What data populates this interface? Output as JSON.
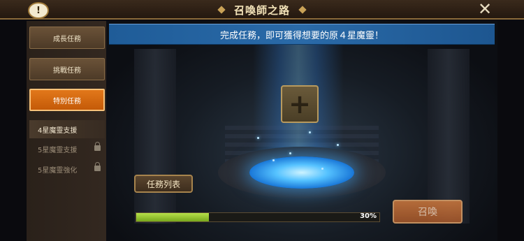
{
  "titlebar": {
    "title": "召喚師之路",
    "help_icon": "speech-bubble-exclamation-icon",
    "close_icon": "close-x-icon"
  },
  "sidebar": {
    "tabs": [
      {
        "label": "成長任務",
        "active": false
      },
      {
        "label": "挑戰任務",
        "active": false
      },
      {
        "label": "特別任務",
        "active": true
      }
    ],
    "sub_items": [
      {
        "label": "4星魔靈支援",
        "active": true,
        "locked": false
      },
      {
        "label": "5星魔靈支援",
        "active": false,
        "locked": true
      },
      {
        "label": "5星魔靈強化",
        "active": false,
        "locked": true
      }
    ]
  },
  "main": {
    "banner_text": "完成任務，即可獲得想要的原４星魔靈！",
    "slot_icon": "plus-icon",
    "list_button": "任務列表",
    "progress": {
      "value": 30,
      "label": "30%"
    },
    "summon_button": "召喚"
  },
  "colors": {
    "accent_orange": "#d8690f",
    "banner_blue": "#2a6aa8",
    "progress_green": "#9ccc30",
    "portal_blue": "#55c2ff"
  }
}
